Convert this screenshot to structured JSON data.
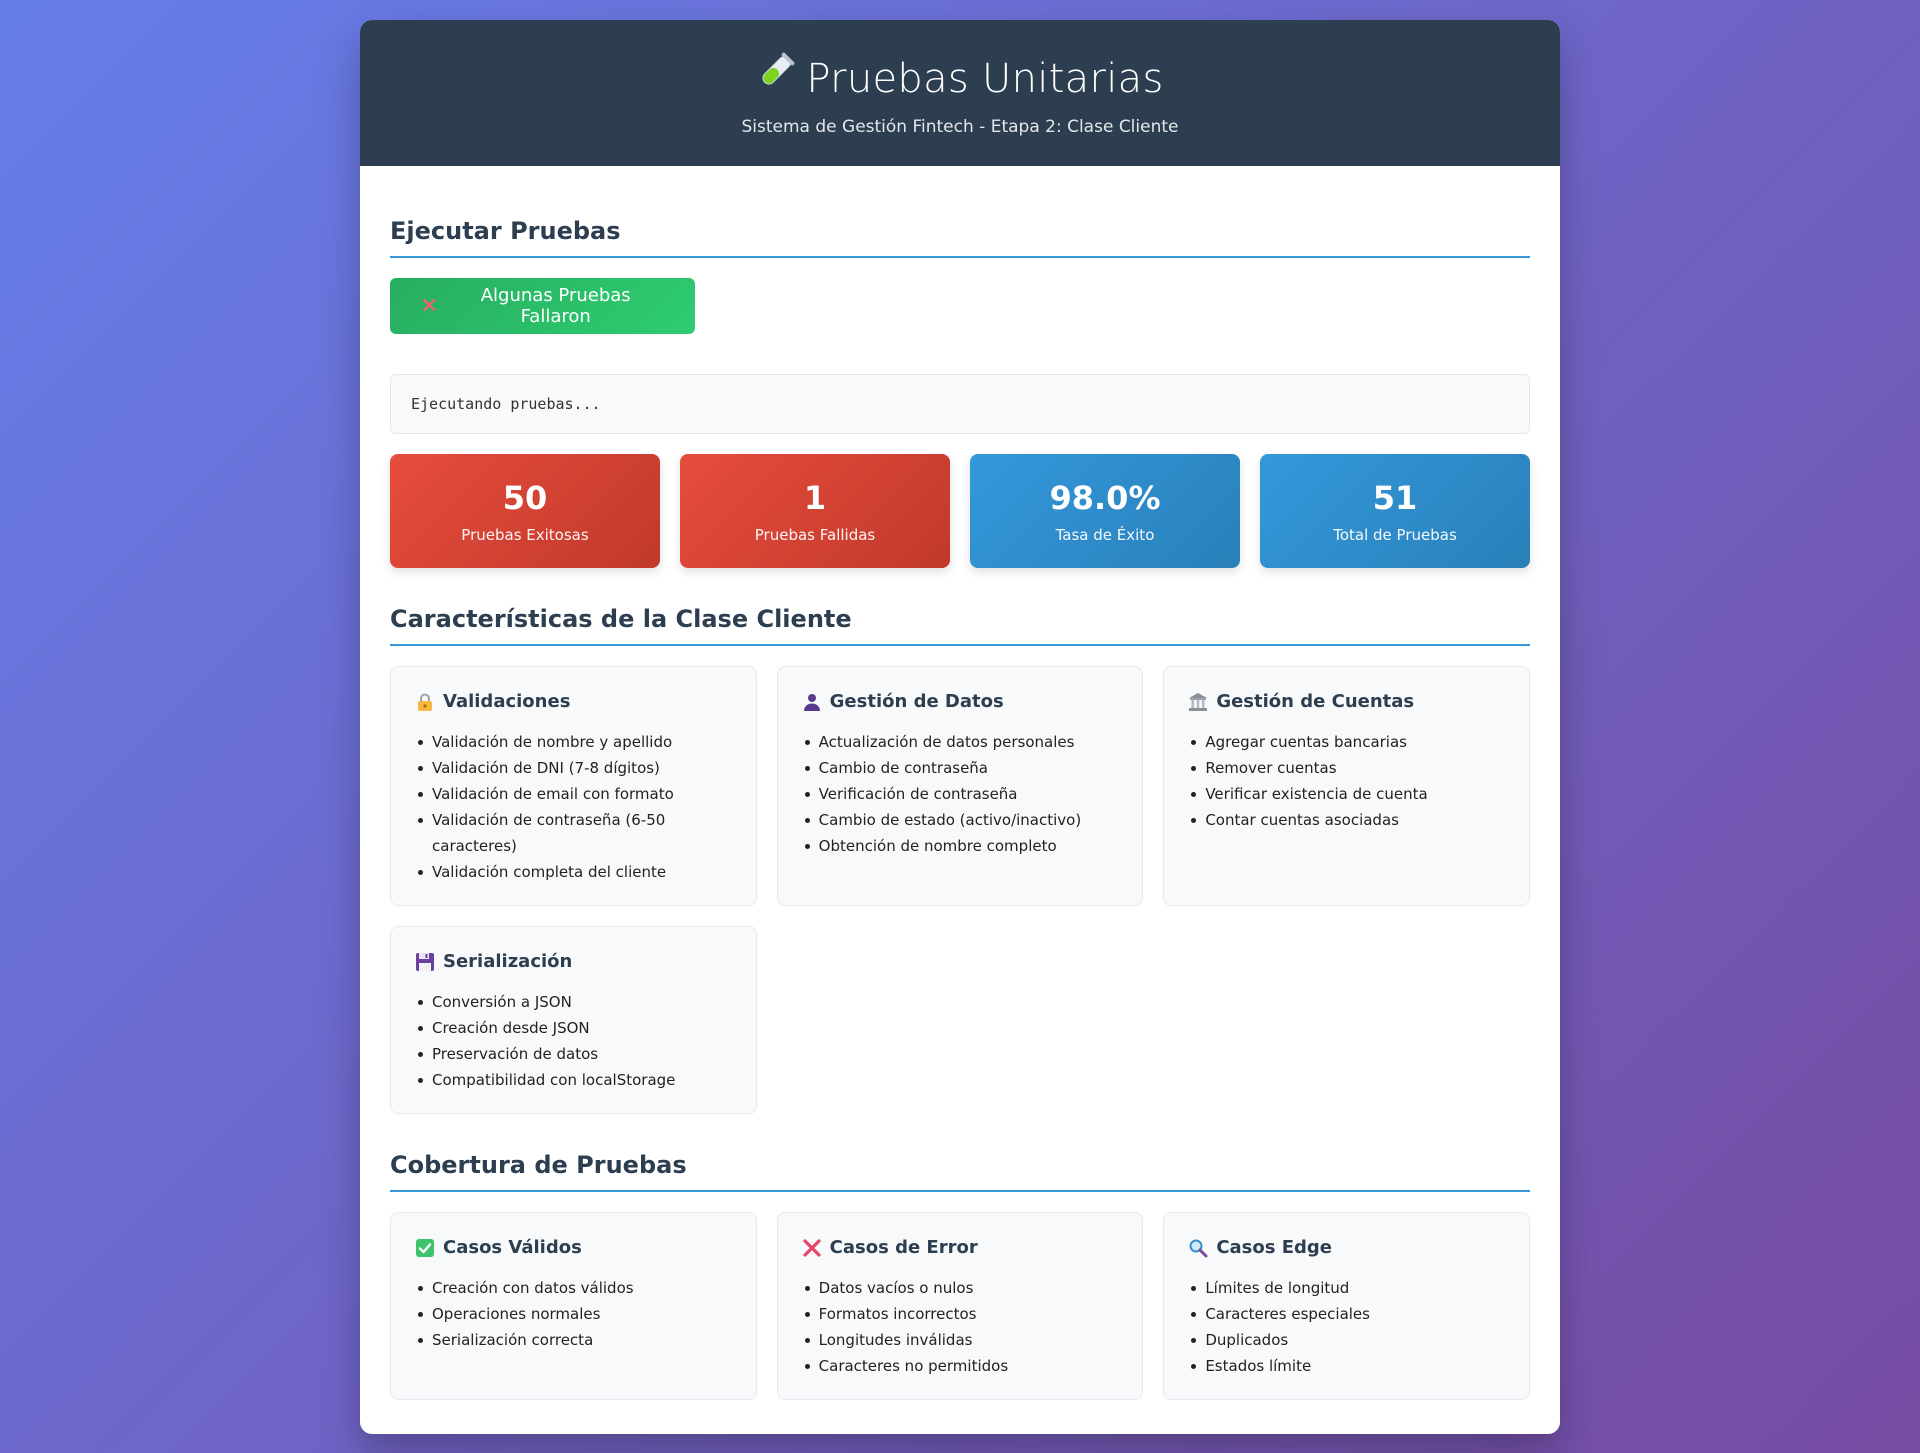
{
  "header": {
    "title": "Pruebas Unitarias",
    "title_icon": "test-tube-icon",
    "subtitle": "Sistema de Gestión Fintech - Etapa 2: Clase Cliente"
  },
  "run": {
    "section_title": "Ejecutar Pruebas",
    "button_label": "Algunas Pruebas Fallaron",
    "button_icon": "cross-mark-icon",
    "output_text": "Ejecutando pruebas..."
  },
  "stats": [
    {
      "value": "50",
      "label": "Pruebas Exitosas",
      "color": "#e74c3c"
    },
    {
      "value": "1",
      "label": "Pruebas Fallidas",
      "color": "#e74c3c"
    },
    {
      "value": "98.0%",
      "label": "Tasa de Éxito",
      "color": "#3498db"
    },
    {
      "value": "51",
      "label": "Total de Pruebas",
      "color": "#3498db"
    }
  ],
  "features": {
    "section_title": "Características de la Clase Cliente",
    "cards": [
      {
        "title": "Validaciones",
        "icon": "lock-icon",
        "items": [
          "Validación de nombre y apellido",
          "Validación de DNI (7-8 dígitos)",
          "Validación de email con formato",
          "Validación de contraseña (6-50 caracteres)",
          "Validación completa del cliente"
        ]
      },
      {
        "title": "Gestión de Datos",
        "icon": "user-icon",
        "items": [
          "Actualización de datos personales",
          "Cambio de contraseña",
          "Verificación de contraseña",
          "Cambio de estado (activo/inactivo)",
          "Obtención de nombre completo"
        ]
      },
      {
        "title": "Gestión de Cuentas",
        "icon": "bank-icon",
        "items": [
          "Agregar cuentas bancarias",
          "Remover cuentas",
          "Verificar existencia de cuenta",
          "Contar cuentas asociadas"
        ]
      },
      {
        "title": "Serialización",
        "icon": "floppy-disk-icon",
        "items": [
          "Conversión a JSON",
          "Creación desde JSON",
          "Preservación de datos",
          "Compatibilidad con localStorage"
        ]
      }
    ]
  },
  "coverage": {
    "section_title": "Cobertura de Pruebas",
    "cards": [
      {
        "title": "Casos Válidos",
        "icon": "check-mark-icon",
        "items": [
          "Creación con datos válidos",
          "Operaciones normales",
          "Serialización correcta"
        ]
      },
      {
        "title": "Casos de Error",
        "icon": "cross-mark-icon",
        "items": [
          "Datos vacíos o nulos",
          "Formatos incorrectos",
          "Longitudes inválidas",
          "Caracteres no permitidos"
        ]
      },
      {
        "title": "Casos Edge",
        "icon": "magnifier-icon",
        "items": [
          "Límites de longitud",
          "Caracteres especiales",
          "Duplicados",
          "Estados límite"
        ]
      }
    ]
  }
}
